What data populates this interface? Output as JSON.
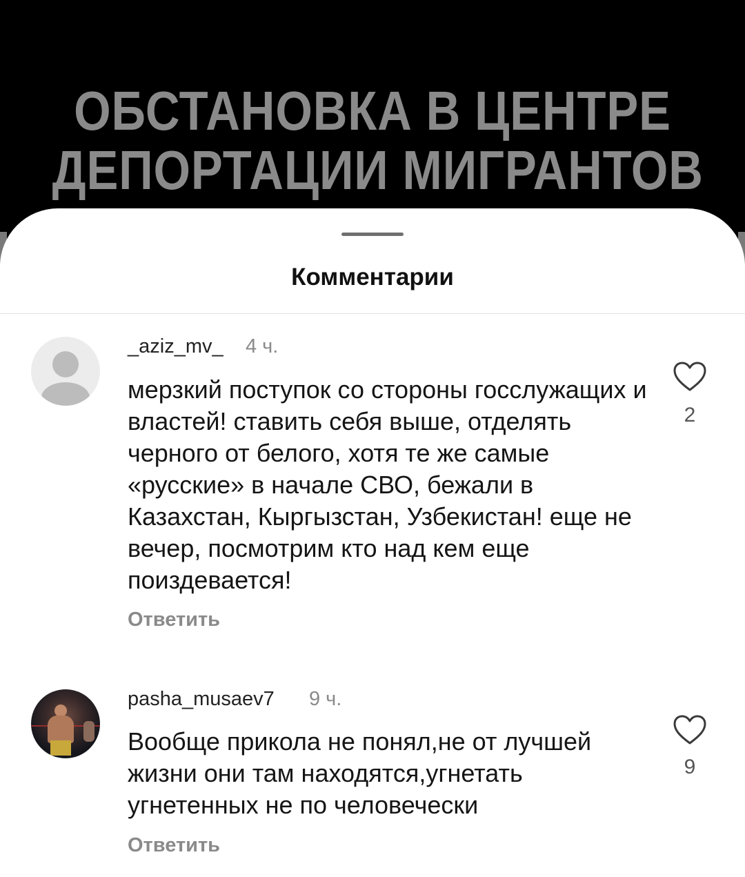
{
  "video": {
    "title_line1": "ОБСТАНОВКА В ЦЕНТРЕ",
    "title_line2": "ДЕПОРТАЦИИ МИГРАНТОВ"
  },
  "sheet": {
    "title": "Комментарии"
  },
  "comments": [
    {
      "username": "_aziz_mv_",
      "time": "4 ч.",
      "text": "мерзкий поступок со стороны госслужащих и властей! ставить себя выше, отделять черного от белого, хотя те же самые «русские» в начале СВО, бежали в Казахстан, Кыргызстан, Узбекистан! еще не вечер, посмотрим кто над кем еще поиздевается!",
      "reply_label": "Ответить",
      "likes": "2",
      "like_icon": "heart-outline-icon",
      "avatar": "default-avatar"
    },
    {
      "username": "pasha_musaev7",
      "time": "9 ч.",
      "text": "Вообще прикола не понял,не от лучшей жизни они там находятся,угнетать угнетенных не по человечески",
      "reply_label": "Ответить",
      "likes": "9",
      "like_icon": "heart-outline-icon",
      "avatar": "photo-avatar"
    }
  ]
}
